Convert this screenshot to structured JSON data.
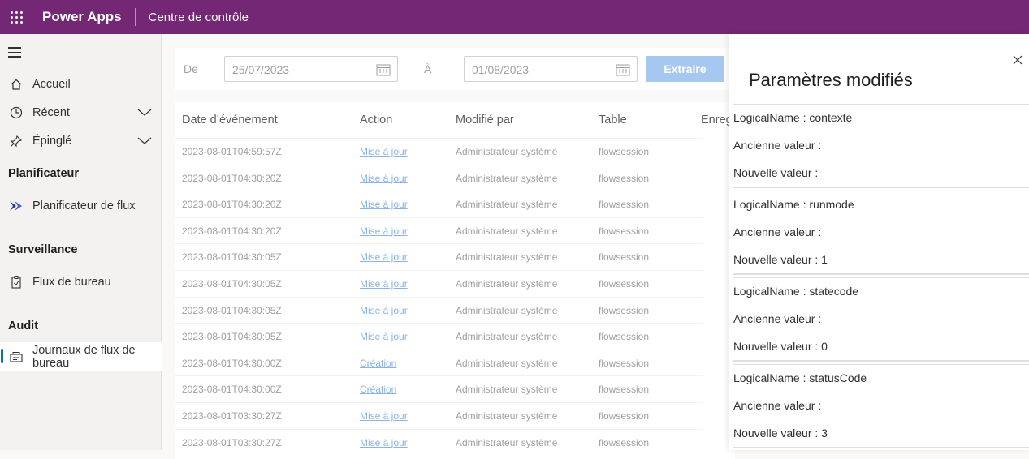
{
  "header": {
    "app_name": "Power Apps",
    "subtitle": "Centre de contrôle"
  },
  "sidebar": {
    "items": [
      {
        "label": "Accueil",
        "icon": "home-icon"
      },
      {
        "label": "Récent",
        "icon": "clock-icon"
      },
      {
        "label": "Épinglé",
        "icon": "pin-icon"
      }
    ],
    "sections": [
      {
        "title": "Planificateur",
        "item": "Planificateur de flux",
        "icon": "flow-scheduler-icon"
      },
      {
        "title": "Surveillance",
        "item": "Flux de bureau",
        "icon": "desktop-flow-icon"
      },
      {
        "title": "Audit",
        "item": "Journaux de flux de bureau",
        "icon": "audit-log-icon"
      }
    ]
  },
  "filter": {
    "from_label": "De",
    "from_value": "25/07/2023",
    "to_label": "À",
    "to_value": "01/08/2023",
    "extract_label": "Extraire"
  },
  "table": {
    "columns": [
      "Date d’événement",
      "Action",
      "Modifié par",
      "Table",
      "Enreg"
    ],
    "rows": [
      [
        "2023-08-01T04:59:57Z",
        "Mise à jour",
        "Administrateur système",
        "flowsession"
      ],
      [
        "2023-08-01T04:30:20Z",
        "Mise à jour",
        "Administrateur système",
        "flowsession"
      ],
      [
        "2023-08-01T04:30:20Z",
        "Mise à jour",
        "Administrateur système",
        "flowsession"
      ],
      [
        "2023-08-01T04:30:20Z",
        "Mise à jour",
        "Administrateur système",
        "flowsession"
      ],
      [
        "2023-08-01T04:30:05Z",
        "Mise à jour",
        "Administrateur système",
        "flowsession"
      ],
      [
        "2023-08-01T04:30:05Z",
        "Mise à jour",
        "Administrateur système",
        "flowsession"
      ],
      [
        "2023-08-01T04:30:05Z",
        "Mise à jour",
        "Administrateur système",
        "flowsession"
      ],
      [
        "2023-08-01T04:30:05Z",
        "Mise à jour",
        "Administrateur système",
        "flowsession"
      ],
      [
        "2023-08-01T04:30:00Z",
        "Création",
        "Administrateur système",
        "flowsession"
      ],
      [
        "2023-08-01T04:30:00Z",
        "Création",
        "Administrateur système",
        "flowsession"
      ],
      [
        "2023-08-01T03:30:27Z",
        "Mise à jour",
        "Administrateur système",
        "flowsession"
      ],
      [
        "2023-08-01T03:30:27Z",
        "Mise à jour",
        "Administrateur système",
        "flowsession"
      ]
    ]
  },
  "panel": {
    "title": "Paramètres modifiés",
    "cards": [
      {
        "name": "LogicalName : contexte",
        "old": "Ancienne valeur :",
        "new": "Nouvelle valeur :"
      },
      {
        "name": "LogicalName : runmode",
        "old": "Ancienne valeur :",
        "new": "Nouvelle valeur : 1"
      },
      {
        "name": "LogicalName : statecode",
        "old": "Ancienne valeur :",
        "new": "Nouvelle valeur : 0"
      },
      {
        "name": "LogicalName : statusCode",
        "old": "Ancienne valeur :",
        "new": "Nouvelle valeur : 3"
      }
    ]
  },
  "colors": {
    "brand": "#742774",
    "link": "#0f6cbd",
    "button_disabled": "#a6c8f0"
  }
}
